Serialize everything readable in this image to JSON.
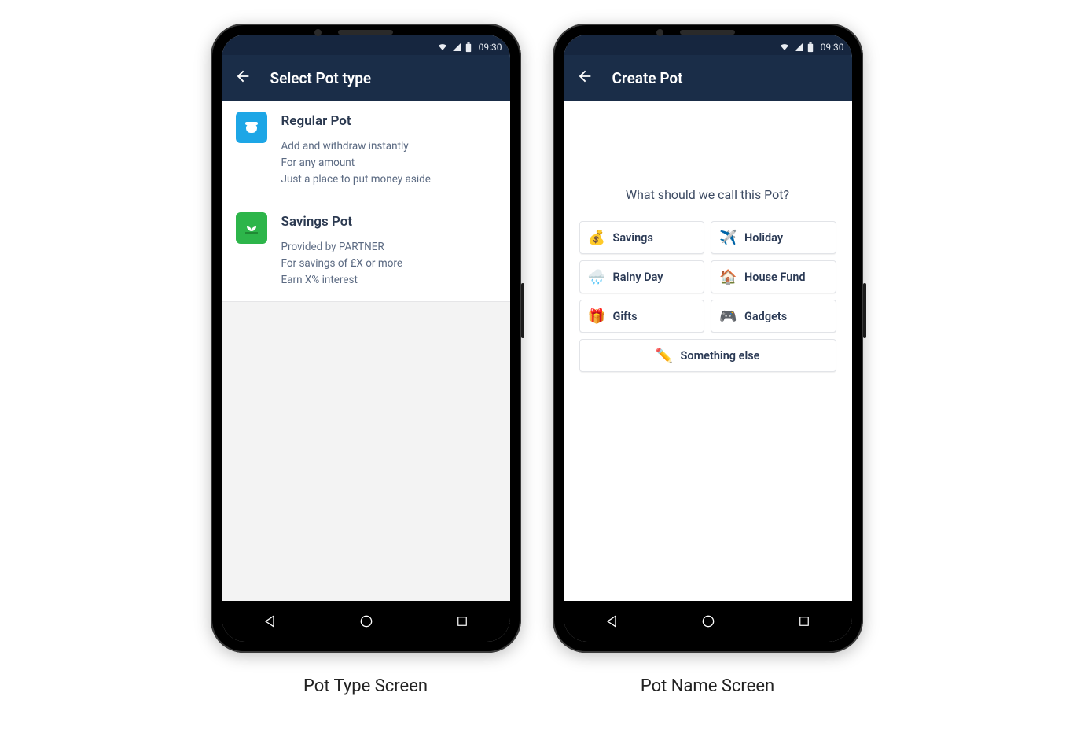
{
  "status": {
    "time": "09:30"
  },
  "screenA": {
    "title": "Select Pot type",
    "options": [
      {
        "title": "Regular Pot",
        "desc1": "Add and withdraw instantly",
        "desc2": "For any amount",
        "desc3": "Just a place to put money aside"
      },
      {
        "title": "Savings Pot",
        "desc1": "Provided by PARTNER",
        "desc2": "For savings of £X or more",
        "desc3": "Earn X% interest"
      }
    ]
  },
  "screenB": {
    "title": "Create Pot",
    "prompt": "What should we call this Pot?",
    "chips": [
      {
        "emoji": "💰",
        "label": "Savings"
      },
      {
        "emoji": "✈️",
        "label": "Holiday"
      },
      {
        "emoji": "🌧️",
        "label": "Rainy Day"
      },
      {
        "emoji": "🏠",
        "label": "House Fund"
      },
      {
        "emoji": "🎁",
        "label": "Gifts"
      },
      {
        "emoji": "🎮",
        "label": "Gadgets"
      }
    ],
    "something_else": {
      "emoji": "✏️",
      "label": "Something else"
    }
  },
  "captions": {
    "a": "Pot Type Screen",
    "b": "Pot Name Screen"
  },
  "icons": {
    "wifi": "wifi-icon",
    "signal": "signal-icon",
    "battery": "battery-icon",
    "back": "back-arrow-icon"
  }
}
